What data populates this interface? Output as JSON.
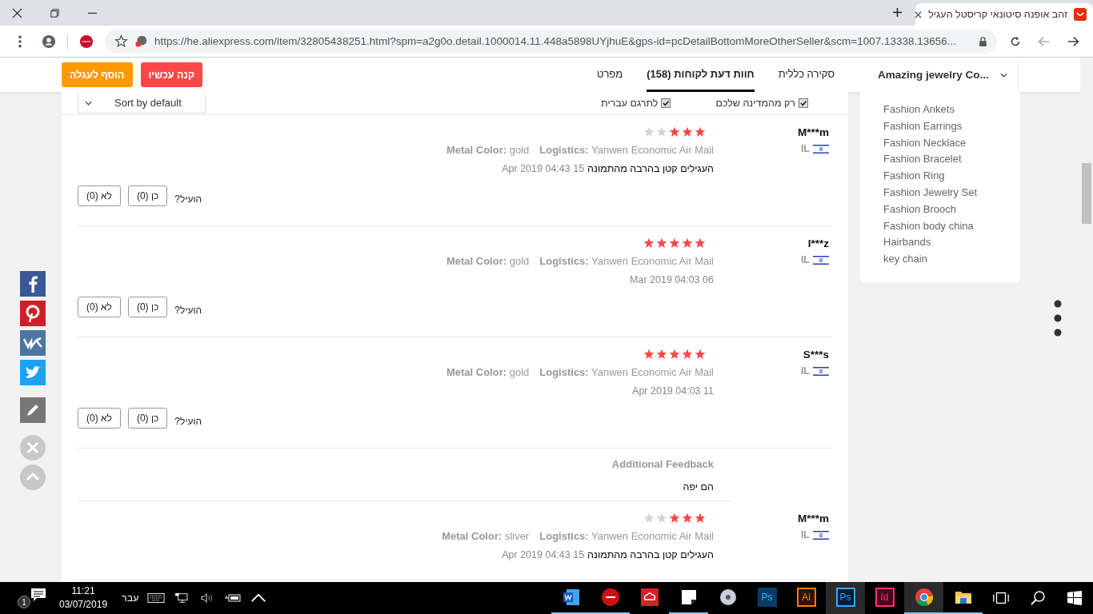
{
  "browser": {
    "tab_title": "זהב אופנה סיטונאי קריסטל העגיל",
    "url": "https://he.aliexpress.com/item/32805438251.html?spm=a2g0o.detail.1000014.11.448a5898UYjhuE&gps-id=pcDetailBottomMoreOtherSeller&scm=1007.13338.13656..."
  },
  "header": {
    "buttons": [
      {
        "label": "קנה עכשיו",
        "kind": "buy"
      },
      {
        "label": "הוסף לעגלה",
        "kind": "cart"
      }
    ],
    "tabs": [
      {
        "label": "סקירה כללית",
        "selected": false
      },
      {
        "label": "חוות דעת לקוחות (158)",
        "selected": true
      },
      {
        "label": "מפרט",
        "selected": false
      }
    ],
    "store_name": "Amazing jewelry Co..."
  },
  "filters": [
    {
      "label": "רק מהמדינה שלכם",
      "checked": true
    },
    {
      "label": "לתרגם עברית",
      "checked": true
    }
  ],
  "sort": "Sort by default",
  "reviews": [
    {
      "name": "M***m",
      "country": "IL",
      "stars": 3,
      "metal_label": "Metal Color:",
      "metal": "gold",
      "logistics_label": "Logistics:",
      "logistics": "Yanwen Economic Air Mail",
      "text": "העגילים קטן בהרבה מהתמונה",
      "date": "Apr 2019 04:43 15",
      "helpful": "הועיל?",
      "yes": "כן (0)",
      "no": "לא (0)"
    },
    {
      "name": "I***z",
      "country": "IL",
      "stars": 5,
      "metal_label": "Metal Color:",
      "metal": "gold",
      "logistics_label": "Logistics:",
      "logistics": "Yanwen Economic Air Mail",
      "date": "Mar 2019 04:03 06",
      "helpful": "הועיל?",
      "yes": "כן (0)",
      "no": "לא (0)"
    },
    {
      "name": "S***s",
      "country": "IL",
      "stars": 5,
      "metal_label": "Metal Color:",
      "metal": "gold",
      "logistics_label": "Logistics:",
      "logistics": "Yanwen Economic Air Mail",
      "date": "Apr 2019 04:03 11",
      "helpful": "הועיל?",
      "yes": "כן (0)",
      "no": "לא (0)",
      "additional_title": "Additional Feedback",
      "additional_text": "הם יפה"
    },
    {
      "name": "M***m",
      "country": "IL",
      "stars": 3,
      "metal_label": "Metal Color:",
      "metal": "sliver",
      "logistics_label": "Logistics:",
      "logistics": "Yanwen Economic Air Mail",
      "text": "העגילים קטן בהרבה מהתמונה",
      "date": "Apr 2019 04:43 15"
    }
  ],
  "categories": [
    "Fashion Ankets",
    "Fashion Earrings",
    "Fashion Necklace",
    "Fashion Bracelet",
    "Fashion Ring",
    "Fashion Jewelry Set",
    "Fashion Brooch",
    "Fashion body china",
    "Hairbands",
    "key chain"
  ],
  "taskbar": {
    "notification_count": "1",
    "time": "11:21",
    "date": "03/07/2019",
    "language": "עבר",
    "apps": [
      {
        "kind": "explorer",
        "running": true,
        "active": false
      },
      {
        "kind": "chrome",
        "running": true,
        "active": true
      },
      {
        "kind": "id",
        "label": "Id",
        "running": false,
        "active": false
      },
      {
        "kind": "ps",
        "label": "Ps",
        "running": false,
        "active": true
      },
      {
        "kind": "ai",
        "label": "Ai",
        "running": false,
        "active": false
      },
      {
        "kind": "ps-old",
        "label": "Ps",
        "running": false,
        "active": false
      },
      {
        "kind": "disc",
        "running": false,
        "active": false
      },
      {
        "kind": "sticky",
        "running": true,
        "active": false
      },
      {
        "kind": "creative-cloud",
        "running": false,
        "active": false
      },
      {
        "kind": "mobile",
        "running": true,
        "active": false
      },
      {
        "kind": "word",
        "running": true,
        "active": false
      }
    ]
  }
}
